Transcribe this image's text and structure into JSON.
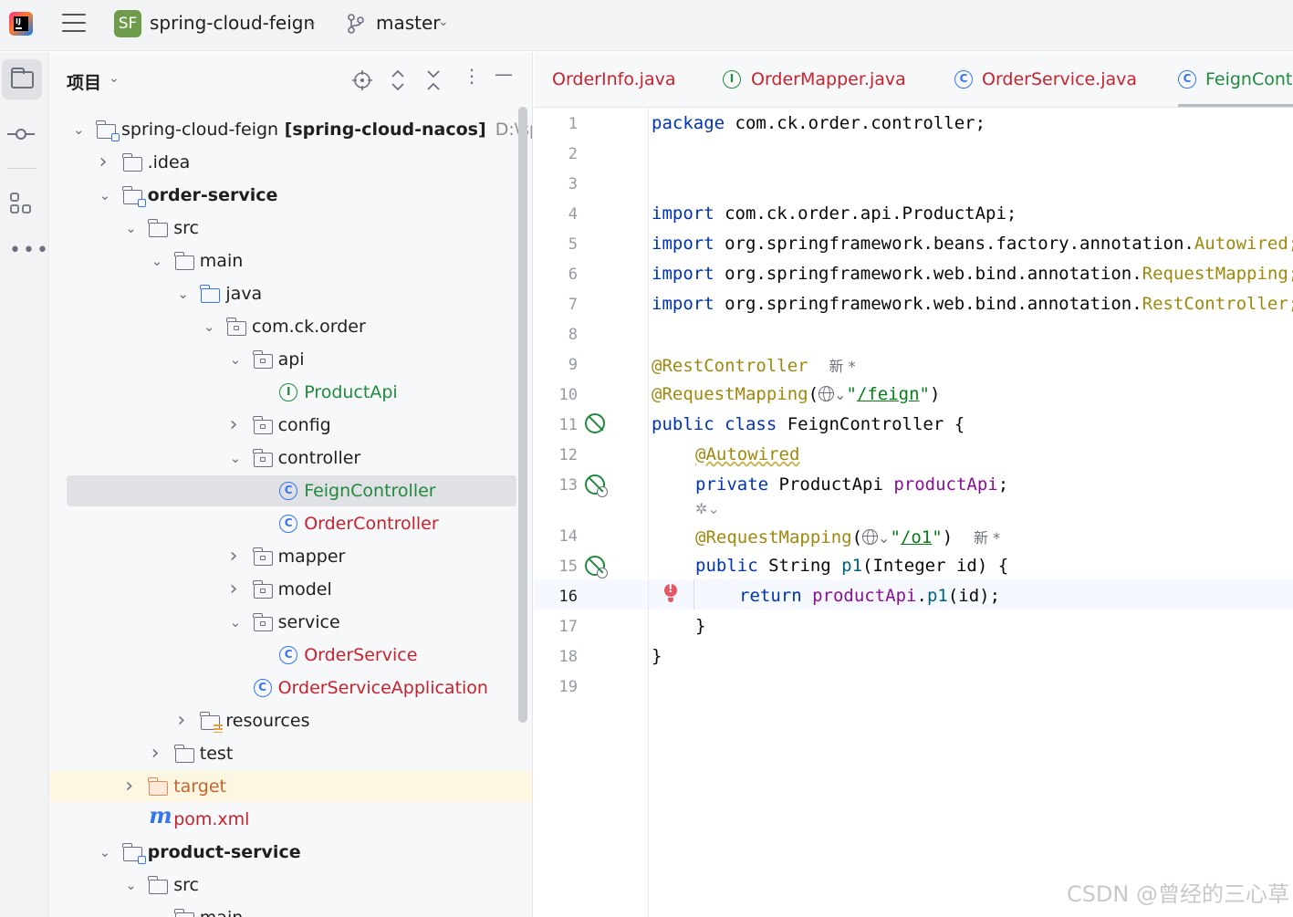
{
  "titlebar": {
    "project_badge": "SF",
    "project_name": "spring-cloud-feign",
    "branch": "master"
  },
  "project_panel": {
    "title": "项目",
    "tree": [
      {
        "label": "spring-cloud-feign",
        "bold_suffix": " [spring-cloud-nacos]",
        "path": "D:\\spring-",
        "level": 0,
        "expanded": true,
        "icon": "module-folder-icon"
      },
      {
        "label": ".idea",
        "level": 1,
        "expanded": false,
        "icon": "folder-icon"
      },
      {
        "label": "order-service",
        "level": 1,
        "expanded": true,
        "icon": "module-folder-icon",
        "bold": true
      },
      {
        "label": "src",
        "level": 2,
        "expanded": true,
        "icon": "folder-icon"
      },
      {
        "label": "main",
        "level": 3,
        "expanded": true,
        "icon": "folder-icon"
      },
      {
        "label": "java",
        "level": 4,
        "expanded": true,
        "icon": "source-folder-icon"
      },
      {
        "label": "com.ck.order",
        "level": 5,
        "expanded": true,
        "icon": "package-icon"
      },
      {
        "label": "api",
        "level": 6,
        "expanded": true,
        "icon": "package-icon"
      },
      {
        "label": "ProductApi",
        "level": 7,
        "icon": "interface-icon",
        "color": "#208a3c"
      },
      {
        "label": "config",
        "level": 6,
        "expanded": false,
        "icon": "package-icon"
      },
      {
        "label": "controller",
        "level": 6,
        "expanded": true,
        "icon": "package-icon"
      },
      {
        "label": "FeignController",
        "level": 7,
        "icon": "class-icon",
        "color": "#208a3c",
        "selected": true
      },
      {
        "label": "OrderController",
        "level": 7,
        "icon": "class-icon",
        "color": "#c7222d"
      },
      {
        "label": "mapper",
        "level": 6,
        "expanded": false,
        "icon": "package-icon"
      },
      {
        "label": "model",
        "level": 6,
        "expanded": false,
        "icon": "package-icon"
      },
      {
        "label": "service",
        "level": 6,
        "expanded": true,
        "icon": "package-icon"
      },
      {
        "label": "OrderService",
        "level": 7,
        "icon": "class-icon",
        "color": "#c7222d"
      },
      {
        "label": "OrderServiceApplication",
        "level": 6,
        "icon": "spring-boot-class-icon",
        "color": "#c7222d"
      },
      {
        "label": "resources",
        "level": 4,
        "expanded": false,
        "icon": "resources-folder-icon"
      },
      {
        "label": "test",
        "level": 3,
        "expanded": false,
        "icon": "folder-icon"
      },
      {
        "label": "target",
        "level": 2,
        "expanded": false,
        "icon": "excluded-folder-icon",
        "color": "#c7622d",
        "highlight": true
      },
      {
        "label": "pom.xml",
        "level": 2,
        "icon": "maven-icon",
        "color": "#c7222d"
      },
      {
        "label": "product-service",
        "level": 1,
        "expanded": true,
        "icon": "module-folder-icon",
        "bold": true
      },
      {
        "label": "src",
        "level": 2,
        "expanded": true,
        "icon": "folder-icon"
      },
      {
        "label": "main",
        "level": 3,
        "expanded": true,
        "icon": "folder-icon"
      }
    ]
  },
  "tabs": [
    {
      "label": "OrderInfo.java",
      "icon": "none",
      "color": "#c7222d"
    },
    {
      "label": "OrderMapper.java",
      "icon": "interface-icon",
      "color": "#c7222d"
    },
    {
      "label": "OrderService.java",
      "icon": "class-icon",
      "color": "#c7222d"
    },
    {
      "label": "FeignController.java",
      "icon": "class-icon",
      "color": "#208a3c",
      "active": true
    }
  ],
  "editor": {
    "line_numbers": [
      "1",
      "2",
      "3",
      "4",
      "5",
      "6",
      "7",
      "8",
      "9",
      "10",
      "11",
      "12",
      "13",
      "14",
      "15",
      "16",
      "17",
      "18",
      "19"
    ],
    "current_line": "16",
    "hints": {
      "new_author_1": "新 *",
      "new_author_2": "新 *"
    },
    "code": {
      "l1_kw": "package",
      "l1_rest": " com.ck.order.controller;",
      "l4_kw": "import",
      "l4_rest": " com.ck.order.api.ProductApi;",
      "l5_kw": "import",
      "l5_rest": " org.springframework.beans.factory.annotation.",
      "l5_cls": "Autowired;",
      "l6_kw": "import",
      "l6_rest": " org.springframework.web.bind.annotation.",
      "l6_cls": "RequestMapping;",
      "l7_kw": "import",
      "l7_rest": " org.springframework.web.bind.annotation.",
      "l7_cls": "RestController;",
      "l9_ann": "@RestController",
      "l10_ann": "@RequestMapping",
      "l10_open": "(",
      "l10_q1": "\"",
      "l10_path": "/feign",
      "l10_q2": "\"",
      "l10_close": ")",
      "l11_kw": "public class",
      "l11_rest": " FeignController {",
      "l12_ann": "@Autowired",
      "l13_kw": "private",
      "l13_type": " ProductApi ",
      "l13_fld": "productApi",
      "l13_semi": ";",
      "l14_ann": "@RequestMapping",
      "l14_open": "(",
      "l14_q1": "\"",
      "l14_path": "/o1",
      "l14_q2": "\"",
      "l14_close": ")",
      "l15_kw": "public",
      "l15_type": " String ",
      "l15_mth": "p1",
      "l15_rest": "(Integer id) {",
      "l16_kw": "return",
      "l16_fld": " productApi",
      "l16_dot": ".",
      "l16_mth": "p1",
      "l16_rest": "(id);",
      "l17": "}",
      "l18": "}"
    }
  },
  "watermark": "CSDN @曾经的三心草"
}
